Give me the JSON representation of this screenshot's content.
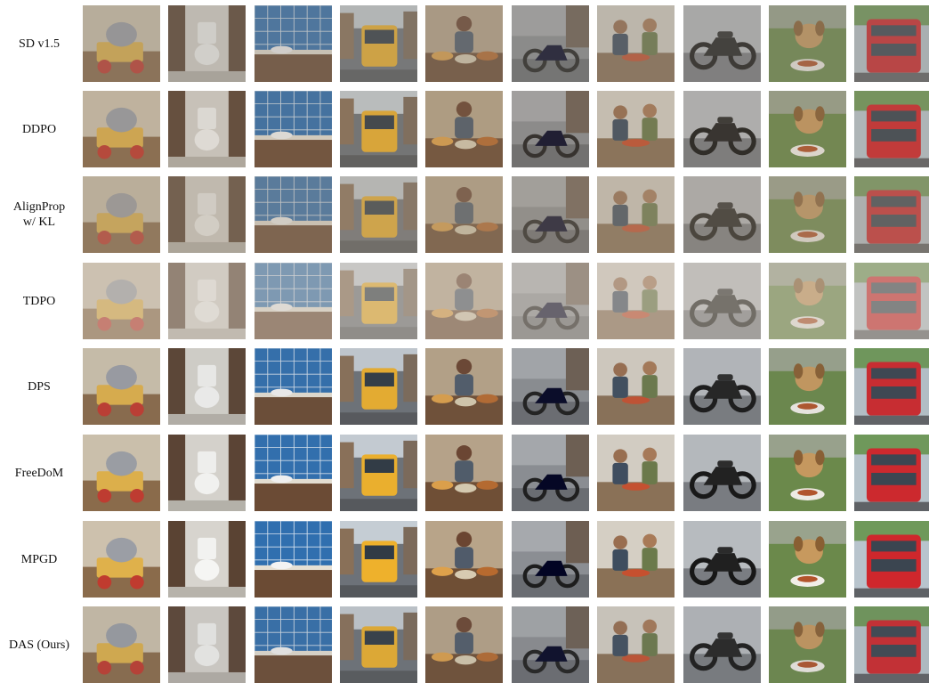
{
  "figure": {
    "rows": [
      {
        "label": "SD v1.5"
      },
      {
        "label": "DDPO"
      },
      {
        "label": "AlignProp\nw/ KL"
      },
      {
        "label": "TDPO"
      },
      {
        "label": "DPS"
      },
      {
        "label": "FreeDoM"
      },
      {
        "label": "MPGD"
      },
      {
        "label": "DAS (Ours)"
      }
    ],
    "columns": [
      {
        "subject": "toy-elephant-cart"
      },
      {
        "subject": "toilet"
      },
      {
        "subject": "blue-tile-kitchen"
      },
      {
        "subject": "city-bus-street"
      },
      {
        "subject": "market-vendor"
      },
      {
        "subject": "motorcycle-street"
      },
      {
        "subject": "people-cooking"
      },
      {
        "subject": "motorcycle"
      },
      {
        "subject": "dog-with-food"
      },
      {
        "subject": "red-double-decker-bus"
      }
    ],
    "styles": [
      {
        "tint": "#8a8378",
        "sat": 0.55
      },
      {
        "tint": "#8c7d6a",
        "sat": 0.75
      },
      {
        "tint": "#9b8e7c",
        "sat": 0.45
      },
      {
        "tint": "#c9c0b4",
        "sat": 0.25
      },
      {
        "tint": "#6f6f6f",
        "sat": 1.0
      },
      {
        "tint": "#6a6a6a",
        "sat": 1.1
      },
      {
        "tint": "#6c6c6c",
        "sat": 1.15
      },
      {
        "tint": "#707070",
        "sat": 0.9
      }
    ]
  }
}
